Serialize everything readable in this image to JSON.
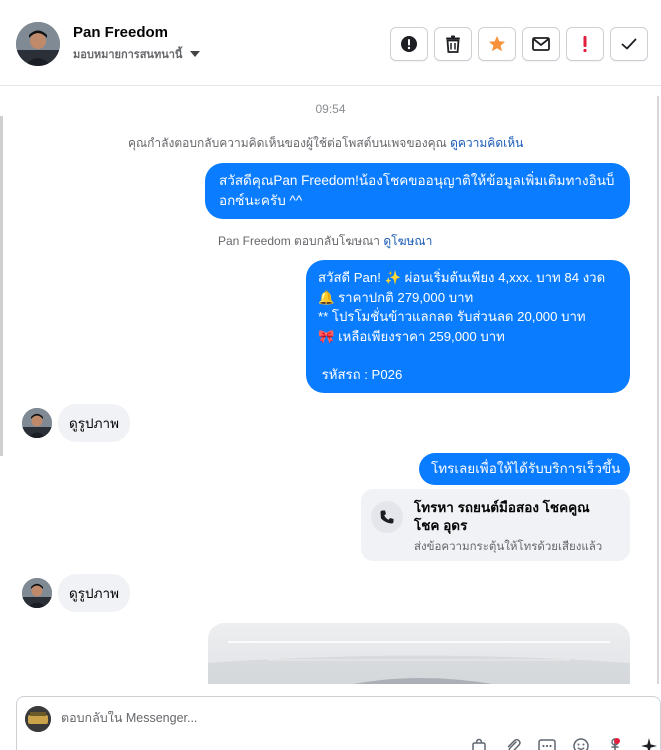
{
  "header": {
    "name": "Pan Freedom",
    "assign_label": "มอบหมายการสนทนานี้",
    "actions": [
      {
        "icon": "alert-circle-icon",
        "label": "spam"
      },
      {
        "icon": "trash-icon",
        "label": "delete"
      },
      {
        "icon": "star-icon",
        "label": "star",
        "color": "#f7923b"
      },
      {
        "icon": "envelope-icon",
        "label": "mark unread"
      },
      {
        "icon": "exclamation-icon",
        "label": "follow up",
        "color": "#e41e3f"
      },
      {
        "icon": "check-icon",
        "label": "done"
      }
    ]
  },
  "thread": {
    "timestamp": "09:54",
    "comment_notice": "คุณกำลังตอบกลับความคิดเห็นของผู้ใช้ต่อโพสต์บนเพจของคุณ",
    "comment_link": "ดูความคิดเห็น",
    "msg1": "สวัสดีคุณPan Freedom!น้องโชคขออนุญาติให้ข้อมูลเพิ่มเติมทางอินบ็อกซ์นะครับ ^^",
    "ad_notice": "Pan Freedom ตอบกลับโฆษณา",
    "ad_link": "ดูโฆษณา",
    "msg2": {
      "line1": "สวัสดี Pan! ✨  ผ่อนเริ่มต้นเพียง 4,xxx. บาท 84 งวด",
      "line2": "🔔 ราคาปกติ 279,000 บาท",
      "line3": "** โปรโมชั่นข้าวแลกลด รับส่วนลด 20,000 บาท",
      "line4": "🎀  เหลือเพียงราคา 259,000 บาท",
      "line5": " รหัสรถ : P026"
    },
    "incoming_1": "ดูรูปภาพ",
    "msg3": "โทรเลยเพื่อให้ได้รับบริการเร็วขึ้น",
    "call_card": {
      "title": "โทรหา รถยนต์มือสอง โชคคูณ โชค อุดร",
      "subtitle": "ส่งข้อความกระตุ้นให้โทรด้วยเสียงแล้ว"
    },
    "incoming_2": "ดูรูปภาพ"
  },
  "composer": {
    "placeholder": "ตอบกลับใน Messenger..."
  },
  "colors": {
    "outgoing_bubble": "#0a7cff",
    "incoming_bubble": "#f0f2f5",
    "link": "#1a5bb8"
  }
}
